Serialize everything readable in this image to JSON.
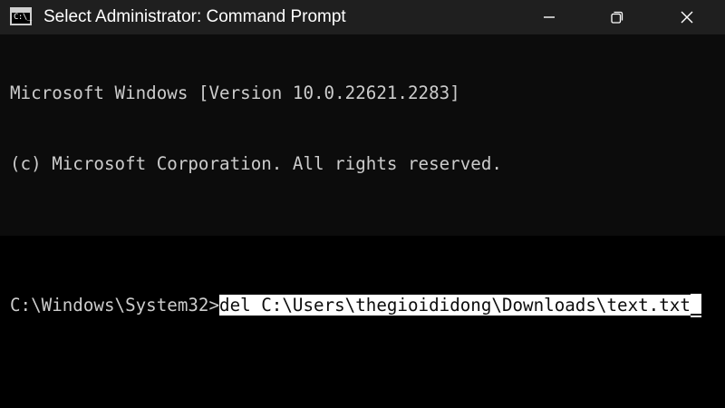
{
  "window": {
    "title": "Select Administrator: Command Prompt",
    "icon_name": "command-prompt-icon",
    "icon_glyph": "C:\\_",
    "controls": {
      "minimize_icon": "minimize-icon",
      "maximize_icon": "restore-icon",
      "close_icon": "close-icon"
    }
  },
  "terminal": {
    "lines": [
      "Microsoft Windows [Version 10.0.22621.2283]",
      "(c) Microsoft Corporation. All rights reserved.",
      ""
    ],
    "prompt": "C:\\Windows\\System32>",
    "command": "del C:\\Users\\thegioididong\\Downloads\\text.txt"
  },
  "colors": {
    "titlebar": "#1f1f1f",
    "console_bg": "#0c0c0c",
    "console_text": "#cccccc",
    "selection_bg": "#ffffff",
    "outer_bg": "#000000"
  }
}
